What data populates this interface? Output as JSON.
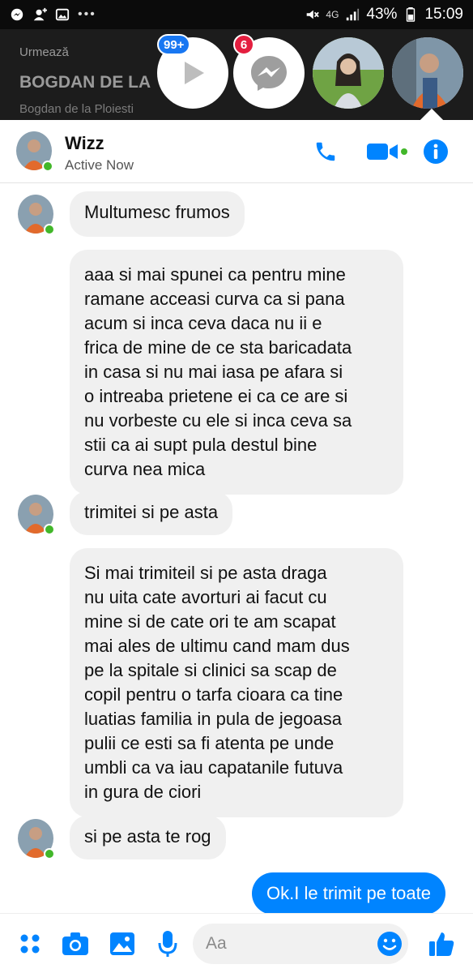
{
  "status_bar": {
    "network": "4G",
    "battery": "43%",
    "time": "15:09"
  },
  "background_page": {
    "follow_label": "Urmează",
    "title": "BOGDAN DE LA",
    "subtitle": "Bogdan de la Ploiesti"
  },
  "chat_heads": [
    {
      "icon": "play-icon",
      "badge": "99+"
    },
    {
      "icon": "messenger-icon",
      "badge": "6"
    },
    {
      "icon": "profile-photo"
    },
    {
      "icon": "profile-photo"
    }
  ],
  "colors": {
    "accent": "#0084ff",
    "online": "#42b72a",
    "badge_blue": "#1877f2",
    "badge_red": "#e41e3f"
  },
  "chat": {
    "contact_name": "Wizz",
    "status": "Active Now"
  },
  "messages": [
    {
      "sender": "contact",
      "text": "Multumesc frumos"
    },
    {
      "sender": "contact",
      "lines": [
        "aaa si mai spunei ca pentru mine",
        "ramane acceasi curva ca si pana",
        "acum si inca ceva daca nu ii e",
        "frica de mine de ce sta baricadata",
        "in casa si nu mai iasa pe afara si",
        "o intreaba prietene ei ca ce are si",
        "nu vorbeste cu ele si inca ceva sa",
        "stii ca ai supt pula destul bine",
        "curva nea mica"
      ]
    },
    {
      "sender": "contact",
      "text": "trimitei si pe asta"
    },
    {
      "sender": "contact",
      "lines": [
        "Si mai trimiteil si pe asta draga",
        "nu uita cate avorturi ai facut cu",
        "mine si de cate ori te am scapat",
        "mai ales de ultimu cand mam dus",
        "pe la spitale si clinici sa scap de",
        "copil pentru o tarfa cioara ca tine",
        "luatias familia in pula de jegoasa",
        "pulii ce esti sa fi atenta pe unde",
        "umbli ca va iau capatanile futuva",
        "in gura de ciori"
      ]
    },
    {
      "sender": "contact",
      "text": "si pe asta te rog"
    },
    {
      "sender": "me",
      "text": "Ok.I le trimit pe toate"
    }
  ],
  "composer": {
    "placeholder": "Aa"
  }
}
